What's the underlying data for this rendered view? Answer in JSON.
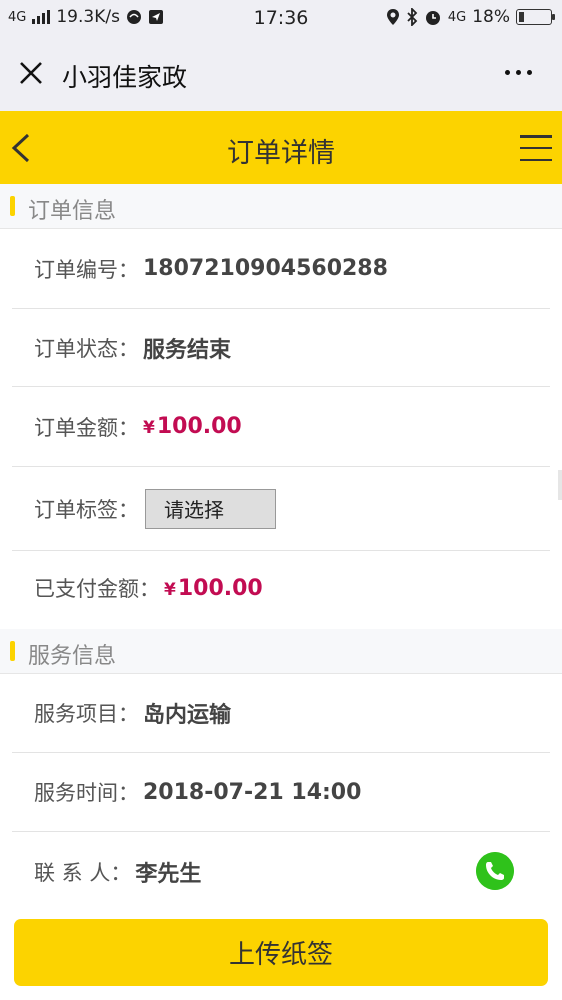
{
  "status_bar": {
    "network": "4G",
    "speed": "19.3K/s",
    "time": "17:36",
    "network_right": "4G",
    "battery": "18%",
    "battery_level": 0.18
  },
  "wechat_bar": {
    "title": "小羽佳家政"
  },
  "header": {
    "title": "订单详情"
  },
  "order_section": {
    "title": "订单信息",
    "rows": [
      {
        "key": "订单编号：",
        "value": "1807210904560288"
      },
      {
        "key": "订单状态：",
        "value": "服务结束"
      },
      {
        "key": "订单金额：",
        "currency": "¥",
        "value": "100.00"
      },
      {
        "key": "订单标签：",
        "select_value": "请选择"
      },
      {
        "key": "已支付金额：",
        "currency": "¥",
        "value": "100.00"
      }
    ]
  },
  "service_section": {
    "title": "服务信息",
    "rows": [
      {
        "key": "服务项目：",
        "value": "岛内运输"
      },
      {
        "key": "服务时间：",
        "value": "2018-07-21 14:00"
      },
      {
        "key": "联 系 人：",
        "value": "李先生"
      }
    ]
  },
  "actions": {
    "upload_label": "上传纸签"
  },
  "colors": {
    "accent": "#fcd300",
    "money": "#c20c52",
    "phone": "#2fc21b"
  }
}
